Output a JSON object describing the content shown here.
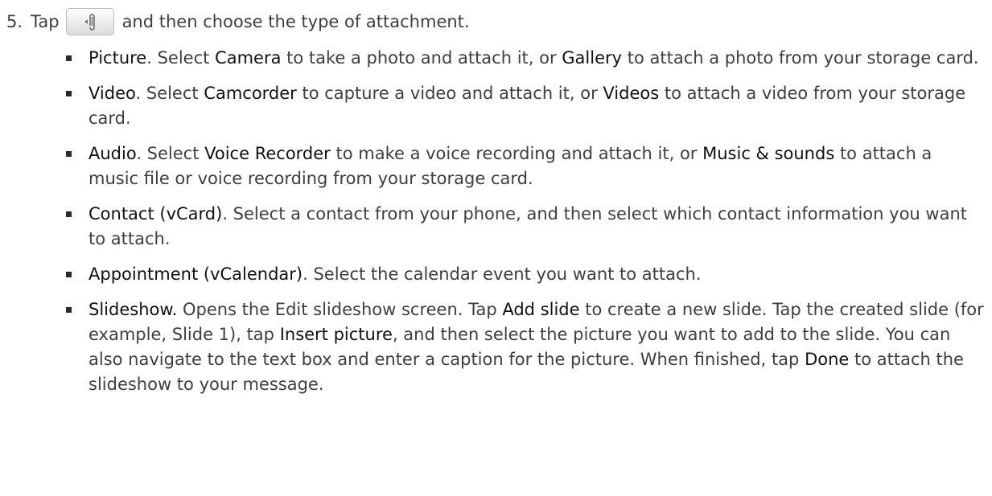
{
  "step": {
    "number": "5.",
    "before": "Tap",
    "after": "and then choose the type of attachment.",
    "button_icon": "paperclip-icon"
  },
  "items": [
    {
      "term": "Picture",
      "p1": ". Select ",
      "k1": "Camera",
      "p2": " to take a photo and attach it, or ",
      "k2": "Gallery",
      "p3": " to attach a photo from your storage card."
    },
    {
      "term": "Video",
      "p1": ". Select ",
      "k1": "Camcorder",
      "p2": " to capture a video and attach it, or ",
      "k2": "Videos",
      "p3": " to attach a video from your storage card."
    },
    {
      "term": "Audio",
      "p1": ". Select ",
      "k1": "Voice Recorder",
      "p2": " to make a voice recording and attach it, or ",
      "k2": "Music & sounds",
      "p3": " to attach a music file or voice recording from your storage card."
    },
    {
      "term": "Contact (vCard)",
      "p1": ". Select a contact from your phone, and then select which contact information you want to attach."
    },
    {
      "term": "Appointment (vCalendar)",
      "p1": ". Select the calendar event you want to attach."
    },
    {
      "term": "Slideshow.",
      "p1": " Opens the Edit slideshow screen. Tap ",
      "k1": "Add slide",
      "p2": " to create a new slide. Tap the created slide (for example, Slide 1), tap ",
      "k2": "Insert picture",
      "p3": ", and then select the picture you want to add to the slide. You can also navigate to the text box and enter a caption for the picture. When finished, tap ",
      "k3": "Done",
      "p4": " to attach the slideshow to your message."
    }
  ]
}
